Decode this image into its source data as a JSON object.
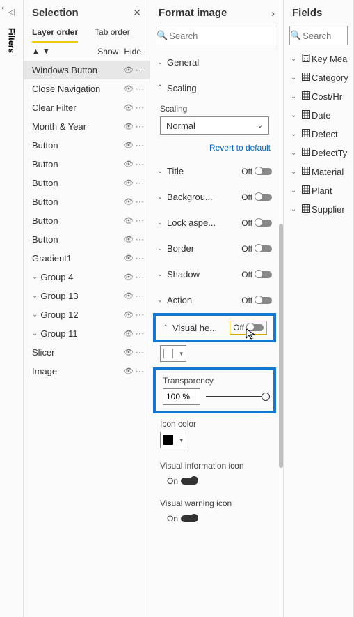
{
  "filters_tab": "Filters",
  "selection": {
    "title": "Selection",
    "tabs": {
      "layer": "Layer order",
      "tab": "Tab order"
    },
    "show": "Show",
    "hide": "Hide",
    "items": [
      {
        "label": "Windows Button",
        "selected": true
      },
      {
        "label": "Close Navigation"
      },
      {
        "label": "Clear Filter"
      },
      {
        "label": "Month & Year"
      },
      {
        "label": "Button"
      },
      {
        "label": "Button"
      },
      {
        "label": "Button"
      },
      {
        "label": "Button"
      },
      {
        "label": "Button"
      },
      {
        "label": "Button"
      },
      {
        "label": "Gradient1"
      },
      {
        "label": "Group 4",
        "caret": "down"
      },
      {
        "label": "Group 13",
        "caret": "down"
      },
      {
        "label": "Group 12",
        "caret": "down"
      },
      {
        "label": "Group 11",
        "caret": "down"
      },
      {
        "label": "Slicer"
      },
      {
        "label": "Image"
      }
    ]
  },
  "format": {
    "title": "Format image",
    "search_ph": "Search",
    "general": "General",
    "scaling": "Scaling",
    "scaling_label": "Scaling",
    "scaling_value": "Normal",
    "revert": "Revert to default",
    "rows": [
      {
        "label": "Title",
        "state": "Off"
      },
      {
        "label": "Backgrou...",
        "state": "Off"
      },
      {
        "label": "Lock aspe...",
        "state": "Off"
      },
      {
        "label": "Border",
        "state": "Off"
      },
      {
        "label": "Shadow",
        "state": "Off"
      },
      {
        "label": "Action",
        "state": "Off"
      }
    ],
    "visual_header": {
      "label": "Visual he...",
      "state": "Off"
    },
    "transparency": {
      "label": "Transparency",
      "value": "100 %"
    },
    "icon_color": "Icon color",
    "vis_info": {
      "label": "Visual information icon",
      "state": "On"
    },
    "vis_warn": {
      "label": "Visual warning icon",
      "state": "On"
    }
  },
  "fields": {
    "title": "Fields",
    "search_ph": "Search",
    "items": [
      {
        "label": "Key Mea",
        "kind": "calc"
      },
      {
        "label": "Category",
        "kind": "table"
      },
      {
        "label": "Cost/Hr",
        "kind": "table"
      },
      {
        "label": "Date",
        "kind": "table"
      },
      {
        "label": "Defect",
        "kind": "table"
      },
      {
        "label": "DefectTy",
        "kind": "table"
      },
      {
        "label": "Material",
        "kind": "table"
      },
      {
        "label": "Plant",
        "kind": "table"
      },
      {
        "label": "Supplier",
        "kind": "table"
      }
    ]
  }
}
